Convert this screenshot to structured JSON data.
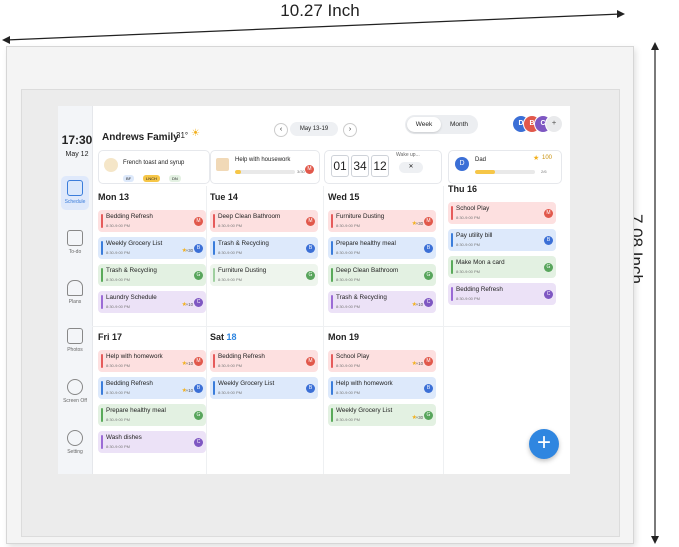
{
  "dimensions": {
    "width": "10.27 Inch",
    "height": "7.08 Inch"
  },
  "sidebar": {
    "time": "17:30",
    "date": "May 12",
    "items": [
      {
        "label": "Schedule",
        "icon": "calendar-icon",
        "active": true
      },
      {
        "label": "To-do",
        "icon": "todo-icon"
      },
      {
        "label": "Plans",
        "icon": "plans-icon"
      },
      {
        "label": "Photos",
        "icon": "photo-icon"
      },
      {
        "label": "Screen Off",
        "icon": "moon-icon"
      },
      {
        "label": "Setting",
        "icon": "settings-icon"
      }
    ]
  },
  "header": {
    "family": "Andrews Family",
    "temp": "31°",
    "weather_icon": "sun-cloud-icon",
    "prev": "‹",
    "next": "›",
    "date_range": "May 13-19",
    "view_week": "Week",
    "view_month": "Month",
    "avatars": [
      {
        "letter": "D",
        "color": "#3b6fd6"
      },
      {
        "letter": "B",
        "color": "#e1584b"
      },
      {
        "letter": "C",
        "color": "#7e57c2"
      },
      {
        "letter": "+",
        "color": "#c7c9cd"
      }
    ]
  },
  "widgets": {
    "meal": {
      "title": "French toast and syrup",
      "tags": [
        "BF",
        "LNCH",
        "DN"
      ]
    },
    "chore": {
      "title": "Help with housework",
      "progress_text": "3/30",
      "avatar": "M",
      "progress": 0.1
    },
    "timer": {
      "digits": [
        "01",
        "34",
        "12"
      ],
      "label": "Wake up...",
      "close": "✕"
    },
    "member": {
      "name": "Dad",
      "avatar": "D",
      "points": "100",
      "progress_text": "2/6",
      "progress": 0.33
    }
  },
  "days_top": [
    {
      "label": "Mon 13",
      "tasks": [
        {
          "name": "Bedding Refresh",
          "time": "8:30-9:00 PM",
          "pts": "",
          "who": "M",
          "bg": "#fde0e0",
          "bar": "#e65b5b",
          "who_color": "#e1584b"
        },
        {
          "name": "Weekly Grocery List",
          "time": "8:30-9:00 PM",
          "pts": "+30",
          "who": "B",
          "bg": "#dde9fb",
          "bar": "#3b7ddb",
          "who_color": "#3b6fd6"
        },
        {
          "name": "Trash & Recycling",
          "time": "8:30-9:00 PM",
          "pts": "",
          "who": "G",
          "bg": "#e3f1e2",
          "bar": "#5aaa5a",
          "who_color": "#58a55c"
        },
        {
          "name": "Laundry Schedule",
          "time": "8:30-9:00 PM",
          "pts": "+10",
          "who": "C",
          "bg": "#ece2f7",
          "bar": "#9b6bd6",
          "who_color": "#7e57c2"
        }
      ]
    },
    {
      "label": "Tue 14",
      "tasks": [
        {
          "name": "Deep Clean Bathroom",
          "time": "8:30-9:00 PM",
          "pts": "",
          "who": "M",
          "bg": "#fde0e0",
          "bar": "#e65b5b",
          "who_color": "#e1584b"
        },
        {
          "name": "Trash & Recycling",
          "time": "8:30-9:00 PM",
          "pts": "",
          "who": "B",
          "bg": "#dde9fb",
          "bar": "#3b7ddb",
          "who_color": "#3b6fd6"
        },
        {
          "name": "Furniture Dusting",
          "time": "8:30-9:00 PM",
          "pts": "",
          "who": "G",
          "bg": "#eef5ed",
          "bar": "#9fd09f",
          "who_color": "#58a55c"
        }
      ]
    },
    {
      "label": "Wed 15",
      "tasks": [
        {
          "name": "Furniture Dusting",
          "time": "8:30-9:00 PM",
          "pts": "+30",
          "who": "M",
          "bg": "#fde0e0",
          "bar": "#e65b5b",
          "who_color": "#e1584b"
        },
        {
          "name": "Prepare healthy meal",
          "time": "8:30-9:00 PM",
          "pts": "",
          "who": "B",
          "bg": "#dde9fb",
          "bar": "#3b7ddb",
          "who_color": "#3b6fd6"
        },
        {
          "name": "Deep Clean Bathroom",
          "time": "8:30-9:00 PM",
          "pts": "",
          "who": "G",
          "bg": "#e3f1e2",
          "bar": "#5aaa5a",
          "who_color": "#58a55c"
        },
        {
          "name": "Trash & Recycling",
          "time": "8:30-9:00 PM",
          "pts": "+10",
          "who": "C",
          "bg": "#ece2f7",
          "bar": "#9b6bd6",
          "who_color": "#7e57c2"
        }
      ]
    },
    {
      "label": "Thu 16",
      "tasks": [
        {
          "name": "School Play",
          "time": "8:30-9:00 PM",
          "pts": "",
          "who": "M",
          "bg": "#fde0e0",
          "bar": "#e65b5b",
          "who_color": "#e1584b"
        },
        {
          "name": "Pay utility bill",
          "time": "8:30-9:00 PM",
          "pts": "",
          "who": "B",
          "bg": "#dde9fb",
          "bar": "#3b7ddb",
          "who_color": "#3b6fd6"
        },
        {
          "name": "Make Mon a card",
          "time": "8:30-9:00 PM",
          "pts": "",
          "who": "G",
          "bg": "#e3f1e2",
          "bar": "#5aaa5a",
          "who_color": "#58a55c"
        },
        {
          "name": "Bedding Refresh",
          "time": "8:30-9:00 PM",
          "pts": "",
          "who": "C",
          "bg": "#ece2f7",
          "bar": "#9b6bd6",
          "who_color": "#7e57c2"
        }
      ]
    }
  ],
  "days_bottom": [
    {
      "label": "Fri 17",
      "tasks": [
        {
          "name": "Help with homework",
          "time": "8:30-9:00 PM",
          "pts": "+10",
          "who": "M",
          "bg": "#fde0e0",
          "bar": "#e65b5b",
          "who_color": "#e1584b"
        },
        {
          "name": "Bedding Refresh",
          "time": "8:30-9:00 PM",
          "pts": "+10",
          "who": "B",
          "bg": "#dde9fb",
          "bar": "#3b7ddb",
          "who_color": "#3b6fd6"
        },
        {
          "name": "Prepare healthy meal",
          "time": "8:30-9:00 PM",
          "pts": "",
          "who": "G",
          "bg": "#e3f1e2",
          "bar": "#5aaa5a",
          "who_color": "#58a55c"
        },
        {
          "name": "Wash dishes",
          "time": "8:30-9:00 PM",
          "pts": "",
          "who": "C",
          "bg": "#ece2f7",
          "bar": "#9b6bd6",
          "who_color": "#7e57c2"
        }
      ]
    },
    {
      "label_day": "Sat",
      "label_num": "18",
      "tasks": [
        {
          "name": "Bedding Refresh",
          "time": "8:30-9:00 PM",
          "pts": "",
          "who": "M",
          "bg": "#fde0e0",
          "bar": "#e65b5b",
          "who_color": "#e1584b"
        },
        {
          "name": "Weekly Grocery List",
          "time": "8:30-9:00 PM",
          "pts": "",
          "who": "B",
          "bg": "#dde9fb",
          "bar": "#3b7ddb",
          "who_color": "#3b6fd6"
        }
      ]
    },
    {
      "label": "Mon 19",
      "tasks": [
        {
          "name": "School Play",
          "time": "8:30-9:00 PM",
          "pts": "+10",
          "who": "M",
          "bg": "#fde0e0",
          "bar": "#e65b5b",
          "who_color": "#e1584b"
        },
        {
          "name": "Help with homework",
          "time": "8:30-9:00 PM",
          "pts": "",
          "who": "B",
          "bg": "#dde9fb",
          "bar": "#3b7ddb",
          "who_color": "#3b6fd6"
        },
        {
          "name": "Weekly Grocery List",
          "time": "8:30-9:00 PM",
          "pts": "+30",
          "who": "G",
          "bg": "#e3f1e2",
          "bar": "#5aaa5a",
          "who_color": "#58a55c"
        }
      ]
    }
  ],
  "fab": "+",
  "colors": {
    "accent": "#2f86e0",
    "today": "#2f86e0"
  }
}
